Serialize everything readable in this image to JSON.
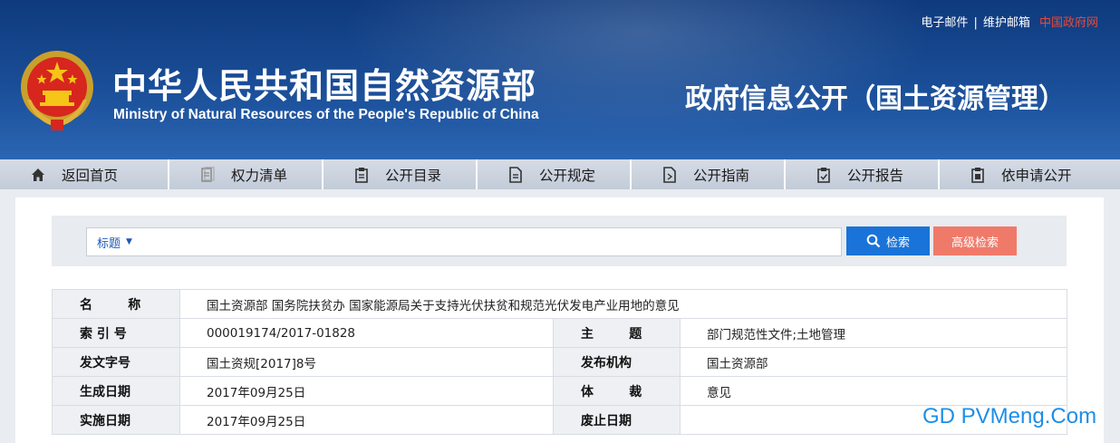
{
  "header": {
    "top_links": [
      "电子邮件",
      "维护邮箱",
      "中国政府网"
    ],
    "separator": "|",
    "org_name_cn": "中华人民共和国自然资源部",
    "org_name_en": "Ministry of Natural Resources of the People's Republic of China",
    "site_title": "政府信息公开（国土资源管理）"
  },
  "nav": {
    "items": [
      {
        "label": "返回首页",
        "icon": "home-icon"
      },
      {
        "label": "权力清单",
        "icon": "list-icon"
      },
      {
        "label": "公开目录",
        "icon": "clipboard-icon"
      },
      {
        "label": "公开规定",
        "icon": "document-icon"
      },
      {
        "label": "公开指南",
        "icon": "guide-icon"
      },
      {
        "label": "公开报告",
        "icon": "report-icon"
      },
      {
        "label": "依申请公开",
        "icon": "apply-icon"
      }
    ]
  },
  "search": {
    "field_select": "标题",
    "value": "",
    "search_label": "检索",
    "advanced_label": "高级检索"
  },
  "info": {
    "name_label": "名　称",
    "name_value": "国土资源部 国务院扶贫办 国家能源局关于支持光伏扶贫和规范光伏发电产业用地的意见",
    "index_label": "索引号",
    "index_value": "000019174/2017-01828",
    "topic_label": "主　题",
    "topic_value": "部门规范性文件;土地管理",
    "docno_label": "发文字号",
    "docno_value": "国土资规[2017]8号",
    "issuer_label": "发布机构",
    "issuer_value": "国土资源部",
    "created_label": "生成日期",
    "created_value": "2017年09月25日",
    "genre_label": "体　裁",
    "genre_value": "意见",
    "effective_label": "实施日期",
    "effective_value": "2017年09月25日",
    "repeal_label": "废止日期",
    "repeal_value": ""
  },
  "watermark": "GD PVMeng.Com",
  "colors": {
    "header_blue": "#1a4e98",
    "search_blue": "#1a73d8",
    "advanced_red": "#f07a6a",
    "gov_link_red": "#e64a3a"
  }
}
